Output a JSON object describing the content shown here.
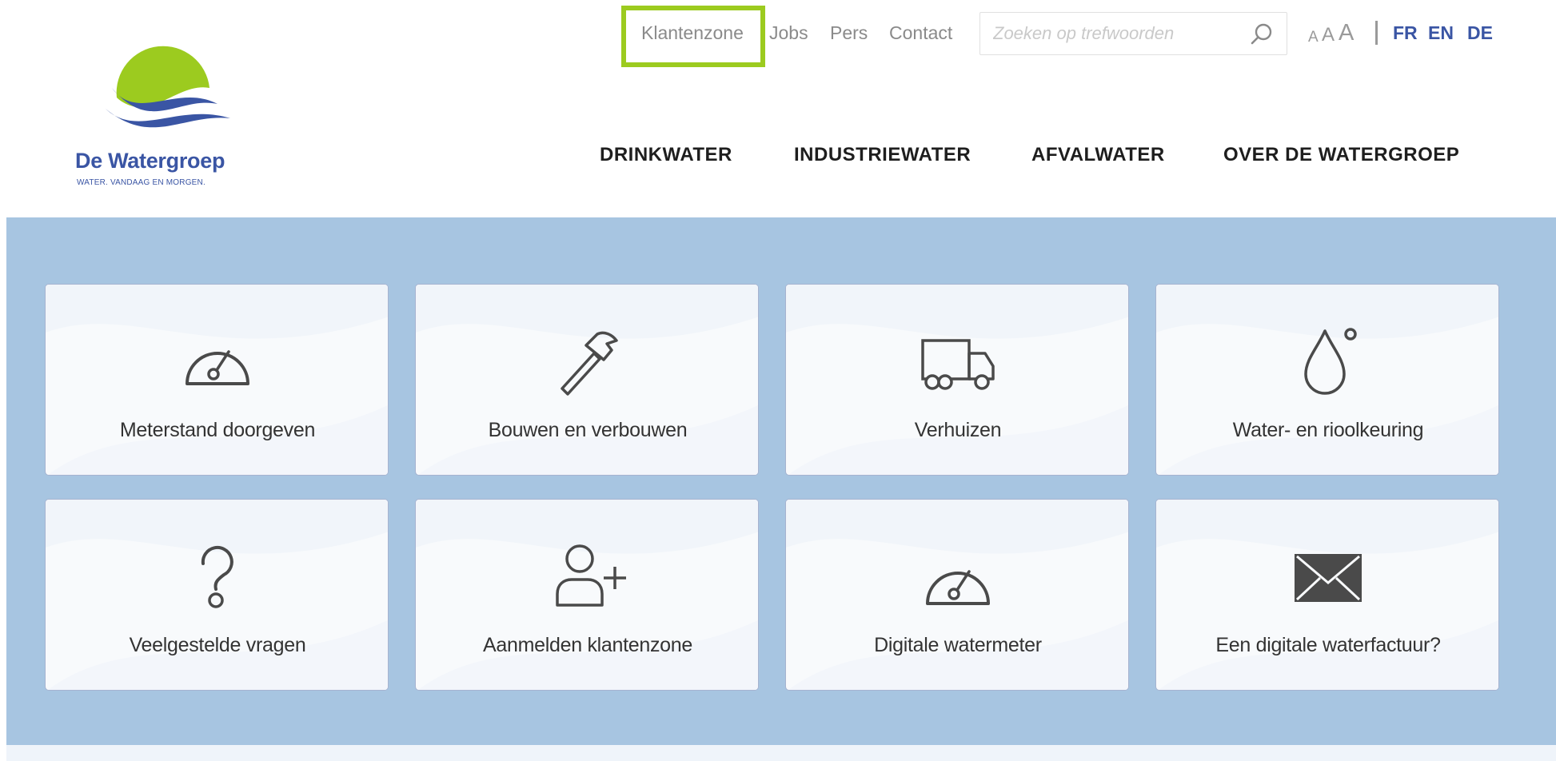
{
  "logo": {
    "name": "De Watergroep",
    "tagline": "WATER. VANDAAG EN MORGEN."
  },
  "topnav": {
    "klantenzone": "Klantenzone",
    "jobs": "Jobs",
    "pers": "Pers",
    "contact": "Contact"
  },
  "search": {
    "placeholder": "Zoeken op trefwoorden"
  },
  "fontsize": {
    "small": "A",
    "medium": "A",
    "large": "A"
  },
  "languages": [
    "FR",
    "EN",
    "DE"
  ],
  "mainnav": [
    "DRINKWATER",
    "INDUSTRIEWATER",
    "AFVALWATER",
    "OVER DE WATERGROEP"
  ],
  "tiles": [
    {
      "label": "Meterstand doorgeven",
      "icon": "meter-icon"
    },
    {
      "label": "Bouwen en verbouwen",
      "icon": "hammer-icon"
    },
    {
      "label": "Verhuizen",
      "icon": "truck-icon"
    },
    {
      "label": "Water- en rioolkeuring",
      "icon": "water-drop-icon"
    },
    {
      "label": "Veelgestelde vragen",
      "icon": "question-icon"
    },
    {
      "label": "Aanmelden klantenzone",
      "icon": "add-user-icon"
    },
    {
      "label": "Digitale watermeter",
      "icon": "meter-icon"
    },
    {
      "label": "Een digitale waterfactuur?",
      "icon": "envelope-icon"
    }
  ],
  "colors": {
    "brand_blue": "#3a55a4",
    "brand_green": "#9ccb1f",
    "band": "#a7c5e1",
    "icon": "#4a4a4a"
  }
}
